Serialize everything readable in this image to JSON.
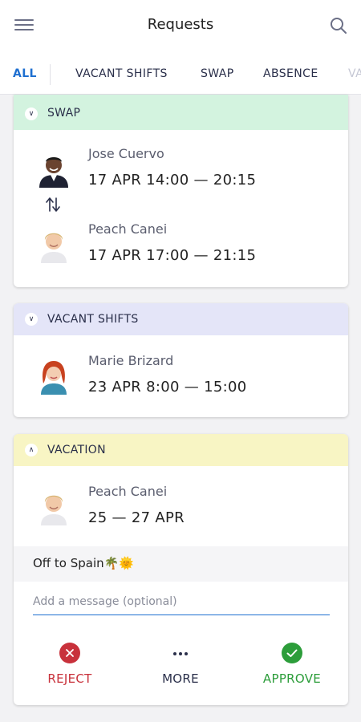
{
  "header": {
    "title": "Requests"
  },
  "tabs": [
    {
      "label": "ALL"
    },
    {
      "label": "VACANT SHIFTS"
    },
    {
      "label": "SWAP"
    },
    {
      "label": "ABSENCE"
    },
    {
      "label": "VA"
    }
  ],
  "colors": {
    "swap_header": "#d3f3df",
    "vacant_header": "#e4e5f8",
    "vacation_header": "#f8f5c4",
    "accent": "#1e6fd0",
    "reject": "#c8313b",
    "more": "#2a2f4a",
    "approve": "#2c9d3a"
  },
  "cards": {
    "swap": {
      "label": "SWAP",
      "people": [
        {
          "name": "Jose Cuervo",
          "date": "17 APR  14:00 — 20:15"
        },
        {
          "name": "Peach Canei",
          "date": "17 APR  17:00 — 21:15"
        }
      ]
    },
    "vacant": {
      "label": "VACANT SHIFTS",
      "people": [
        {
          "name": "Marie Brizard",
          "date": "23 APR  8:00 — 15:00"
        }
      ]
    },
    "vacation": {
      "label": "VACATION",
      "people": [
        {
          "name": "Peach Canei",
          "date": "25 — 27 APR"
        }
      ],
      "note": "Off to Spain🌴🌞",
      "message_placeholder": "Add a message (optional)",
      "actions": {
        "reject": "REJECT",
        "more": "MORE",
        "approve": "APPROVE"
      }
    }
  }
}
